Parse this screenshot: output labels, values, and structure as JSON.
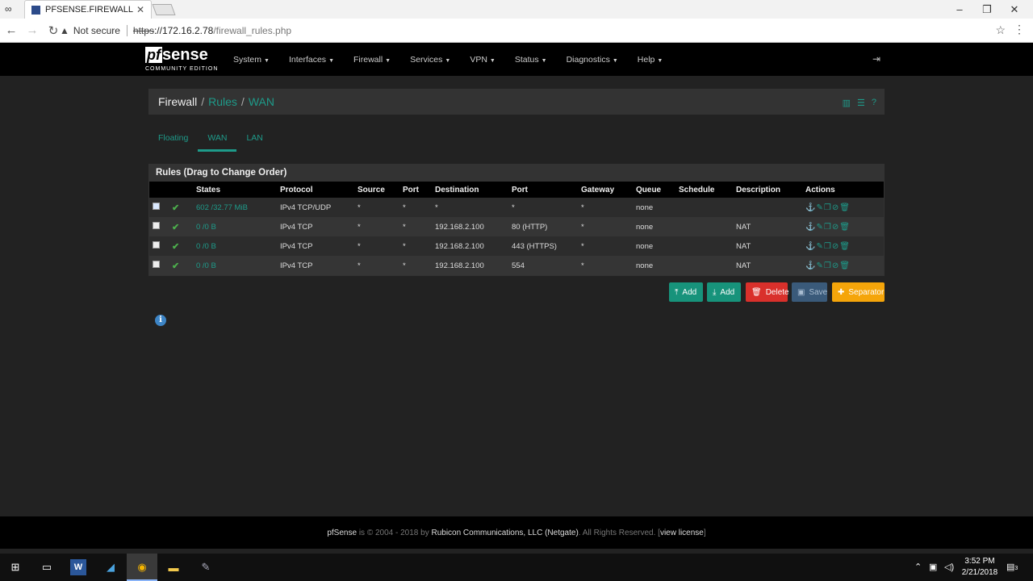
{
  "browser": {
    "tab_title": "PFSENSE.FIREWALL.COM",
    "tab_close": "✕",
    "not_secure": "Not secure",
    "url_scheme": "https",
    "url_host": "://172.16.2.78",
    "url_path": "/firewall_rules.php"
  },
  "brand": {
    "pf": "pf",
    "sense": "sense",
    "edition": "COMMUNITY EDITION"
  },
  "menu": [
    "System",
    "Interfaces",
    "Firewall",
    "Services",
    "VPN",
    "Status",
    "Diagnostics",
    "Help"
  ],
  "breadcrumb": {
    "first": "Firewall",
    "second": "Rules",
    "third": "WAN"
  },
  "tabs": [
    "Floating",
    "WAN",
    "LAN"
  ],
  "rules": {
    "title": "Rules (Drag to Change Order)",
    "headers": [
      "",
      "",
      "States",
      "Protocol",
      "Source",
      "Port",
      "Destination",
      "Port",
      "Gateway",
      "Queue",
      "Schedule",
      "Description",
      "Actions"
    ],
    "rows": [
      {
        "states": "602 /32.77 MiB",
        "protocol": "IPv4 TCP/UDP",
        "source": "*",
        "sport": "*",
        "dest": "*",
        "dport": "*",
        "gateway": "*",
        "queue": "none",
        "schedule": "",
        "description": ""
      },
      {
        "states": "0 /0 B",
        "protocol": "IPv4 TCP",
        "source": "*",
        "sport": "*",
        "dest": "192.168.2.100",
        "dport": "80 (HTTP)",
        "gateway": "*",
        "queue": "none",
        "schedule": "",
        "description": "NAT"
      },
      {
        "states": "0 /0 B",
        "protocol": "IPv4 TCP",
        "source": "*",
        "sport": "*",
        "dest": "192.168.2.100",
        "dport": "443 (HTTPS)",
        "gateway": "*",
        "queue": "none",
        "schedule": "",
        "description": "NAT"
      },
      {
        "states": "0 /0 B",
        "protocol": "IPv4 TCP",
        "source": "*",
        "sport": "*",
        "dest": "192.168.2.100",
        "dport": "554",
        "gateway": "*",
        "queue": "none",
        "schedule": "",
        "description": "NAT"
      }
    ]
  },
  "buttons": {
    "add_top": "Add",
    "add_bottom": "Add",
    "delete": "Delete",
    "save": "Save",
    "separator": "Separator"
  },
  "footer": {
    "brand": "pfSense",
    "is": " is © 2004 - 2018 by ",
    "company": "Rubicon Communications, LLC (Netgate)",
    "rights": ". All Rights Reserved. [",
    "license": "view license",
    "close": "]"
  },
  "taskbar": {
    "time": "3:52 PM",
    "date": "2/21/2018",
    "notif_count": "3"
  },
  "colors": {
    "accent": "#1e9b8a",
    "danger": "#d9302b",
    "warning": "#f5a50a",
    "success": "#4cae4c"
  }
}
